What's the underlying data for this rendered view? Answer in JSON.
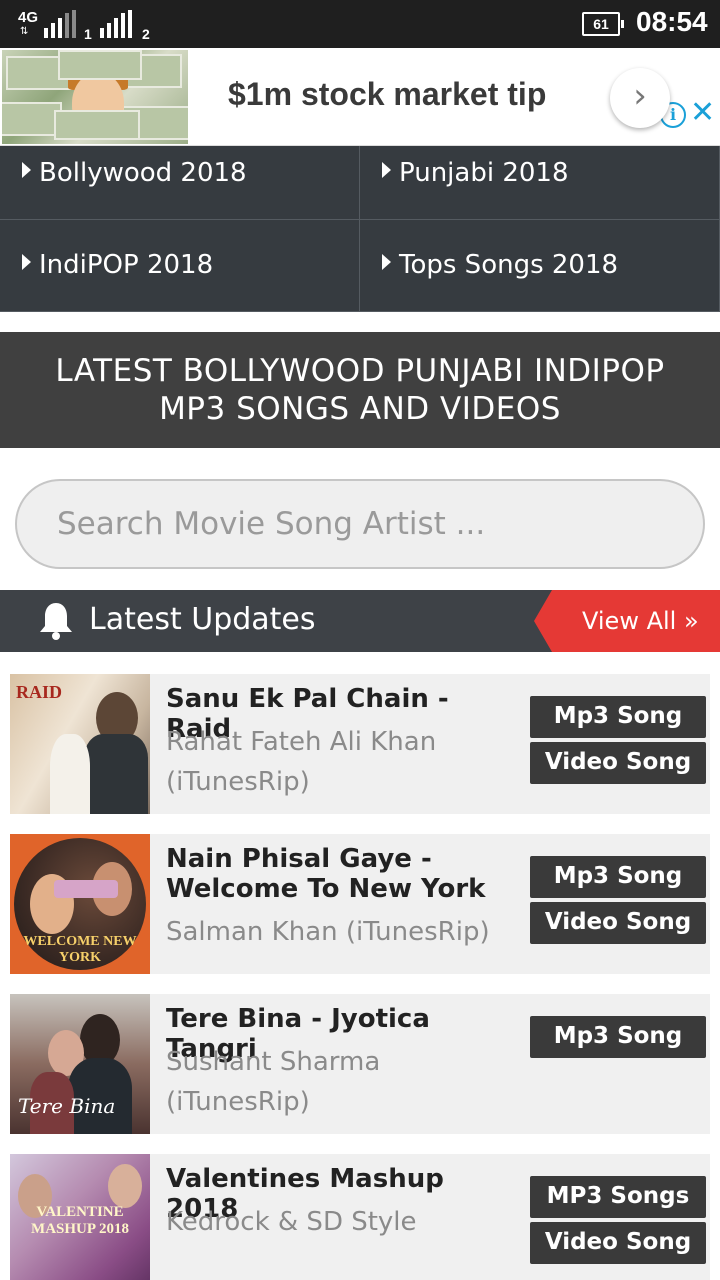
{
  "status_bar": {
    "network": "4G",
    "sim1": "1",
    "sim2": "2",
    "battery": "61",
    "time": "08:54"
  },
  "ad": {
    "title": "$1m stock market tip",
    "image_icon": "money-kid-image",
    "next_icon": "chevron-right-icon",
    "info_icon": "info-icon",
    "close_icon": "close-icon"
  },
  "categories": [
    {
      "label": "Bollywood 2018"
    },
    {
      "label": "Punjabi 2018"
    },
    {
      "label": "IndiPOP 2018"
    },
    {
      "label": "Tops Songs 2018"
    }
  ],
  "banner": {
    "line1": "LATEST BOLLYWOOD PUNJABI INDIPOP",
    "line2": "MP3 SONGS AND VIDEOS"
  },
  "search": {
    "placeholder": "Search Movie Song Artist ..."
  },
  "latest_updates": {
    "title": "Latest Updates",
    "view_all": "View All »",
    "icon": "bell-icon"
  },
  "songs": [
    {
      "title": "Sanu Ek Pal Chain - Raid",
      "artist": "Rahat Fateh Ali Khan (iTunesRip)",
      "buttons": [
        "Mp3 Song",
        "Video Song"
      ],
      "thumb_text": "RAID"
    },
    {
      "title": "Nain Phisal Gaye - Welcome To New York",
      "artist": "Salman Khan (iTunesRip)",
      "buttons": [
        "Mp3 Song",
        "Video Song"
      ],
      "thumb_text": "WELCOME NEW YORK"
    },
    {
      "title": "Tere Bina - Jyotica Tangri",
      "artist": "Sushant Sharma (iTunesRip)",
      "buttons": [
        "Mp3 Song"
      ],
      "thumb_text": "Tere Bina"
    },
    {
      "title": "Valentines Mashup 2018",
      "artist": "Kedrock & SD Style",
      "buttons": [
        "MP3 Songs",
        "Video Song"
      ],
      "thumb_text": "VALENTINE MASHUP 2018"
    }
  ]
}
